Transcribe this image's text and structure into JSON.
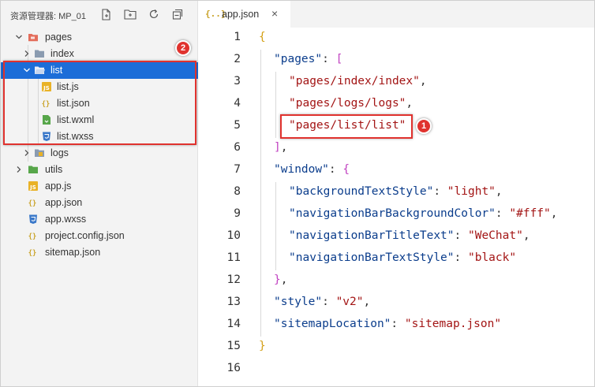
{
  "sidebar": {
    "title": "资源管理器: MP_01",
    "toolbar": [
      {
        "name": "new-file-icon"
      },
      {
        "name": "new-folder-icon"
      },
      {
        "name": "refresh-icon"
      },
      {
        "name": "collapse-all-icon"
      }
    ],
    "tree": [
      {
        "label": "pages",
        "type": "folder-open",
        "expanded": true
      },
      {
        "label": "index",
        "type": "folder",
        "expanded": false
      },
      {
        "label": "list",
        "type": "folder-open",
        "expanded": true,
        "selected": true
      },
      {
        "label": "list.js",
        "type": "js"
      },
      {
        "label": "list.json",
        "type": "json"
      },
      {
        "label": "list.wxml",
        "type": "wxml"
      },
      {
        "label": "list.wxss",
        "type": "wxss"
      },
      {
        "label": "logs",
        "type": "folder",
        "expanded": false
      },
      {
        "label": "utils",
        "type": "folder",
        "expanded": false
      },
      {
        "label": "app.js",
        "type": "js"
      },
      {
        "label": "app.json",
        "type": "json"
      },
      {
        "label": "app.wxss",
        "type": "wxss"
      },
      {
        "label": "project.config.json",
        "type": "json"
      },
      {
        "label": "sitemap.json",
        "type": "json"
      }
    ]
  },
  "editor": {
    "tab": {
      "icon": "{..}",
      "label": "app.json",
      "close": "×"
    },
    "lines": [
      {
        "num": "1",
        "tokens": [
          {
            "t": "{",
            "c": "b1"
          }
        ]
      },
      {
        "num": "2",
        "tokens": [
          {
            "t": "\"pages\"",
            "c": "k"
          },
          {
            "t": ": ",
            "c": "p"
          },
          {
            "t": "[",
            "c": "b2"
          }
        ]
      },
      {
        "num": "3",
        "tokens": [
          {
            "t": "\"pages/index/index\"",
            "c": "s"
          },
          {
            "t": ",",
            "c": "p"
          }
        ]
      },
      {
        "num": "4",
        "tokens": [
          {
            "t": "\"pages/logs/logs\"",
            "c": "s"
          },
          {
            "t": ",",
            "c": "p"
          }
        ]
      },
      {
        "num": "5",
        "tokens": [
          {
            "t": "\"pages/list/list\"",
            "c": "s"
          }
        ]
      },
      {
        "num": "6",
        "tokens": [
          {
            "t": "]",
            "c": "b2"
          },
          {
            "t": ",",
            "c": "p"
          }
        ]
      },
      {
        "num": "7",
        "tokens": [
          {
            "t": "\"window\"",
            "c": "k"
          },
          {
            "t": ": ",
            "c": "p"
          },
          {
            "t": "{",
            "c": "b2"
          }
        ]
      },
      {
        "num": "8",
        "tokens": [
          {
            "t": "\"backgroundTextStyle\"",
            "c": "k"
          },
          {
            "t": ": ",
            "c": "p"
          },
          {
            "t": "\"light\"",
            "c": "s"
          },
          {
            "t": ",",
            "c": "p"
          }
        ]
      },
      {
        "num": "9",
        "tokens": [
          {
            "t": "\"navigationBarBackgroundColor\"",
            "c": "k"
          },
          {
            "t": ": ",
            "c": "p"
          },
          {
            "t": "\"#fff\"",
            "c": "s"
          },
          {
            "t": ",",
            "c": "p"
          }
        ]
      },
      {
        "num": "10",
        "tokens": [
          {
            "t": "\"navigationBarTitleText\"",
            "c": "k"
          },
          {
            "t": ": ",
            "c": "p"
          },
          {
            "t": "\"WeChat\"",
            "c": "s"
          },
          {
            "t": ",",
            "c": "p"
          }
        ]
      },
      {
        "num": "11",
        "tokens": [
          {
            "t": "\"navigationBarTextStyle\"",
            "c": "k"
          },
          {
            "t": ": ",
            "c": "p"
          },
          {
            "t": "\"black\"",
            "c": "s"
          }
        ]
      },
      {
        "num": "12",
        "tokens": [
          {
            "t": "}",
            "c": "b2"
          },
          {
            "t": ",",
            "c": "p"
          }
        ]
      },
      {
        "num": "13",
        "tokens": [
          {
            "t": "\"style\"",
            "c": "k"
          },
          {
            "t": ": ",
            "c": "p"
          },
          {
            "t": "\"v2\"",
            "c": "s"
          },
          {
            "t": ",",
            "c": "p"
          }
        ]
      },
      {
        "num": "14",
        "tokens": [
          {
            "t": "\"sitemapLocation\"",
            "c": "k"
          },
          {
            "t": ": ",
            "c": "p"
          },
          {
            "t": "\"sitemap.json\"",
            "c": "s"
          }
        ]
      },
      {
        "num": "15",
        "tokens": [
          {
            "t": "}",
            "c": "b1"
          }
        ]
      },
      {
        "num": "16",
        "tokens": []
      }
    ]
  },
  "annotations": {
    "badge1": "1",
    "badge2": "2"
  },
  "colors": {
    "selection": "#1c6dd8",
    "annotation": "#e0322e",
    "json_key": "#0b3d8c",
    "json_string": "#a31515",
    "bracket_outer": "#d4a017",
    "bracket_inner": "#c142c1"
  }
}
